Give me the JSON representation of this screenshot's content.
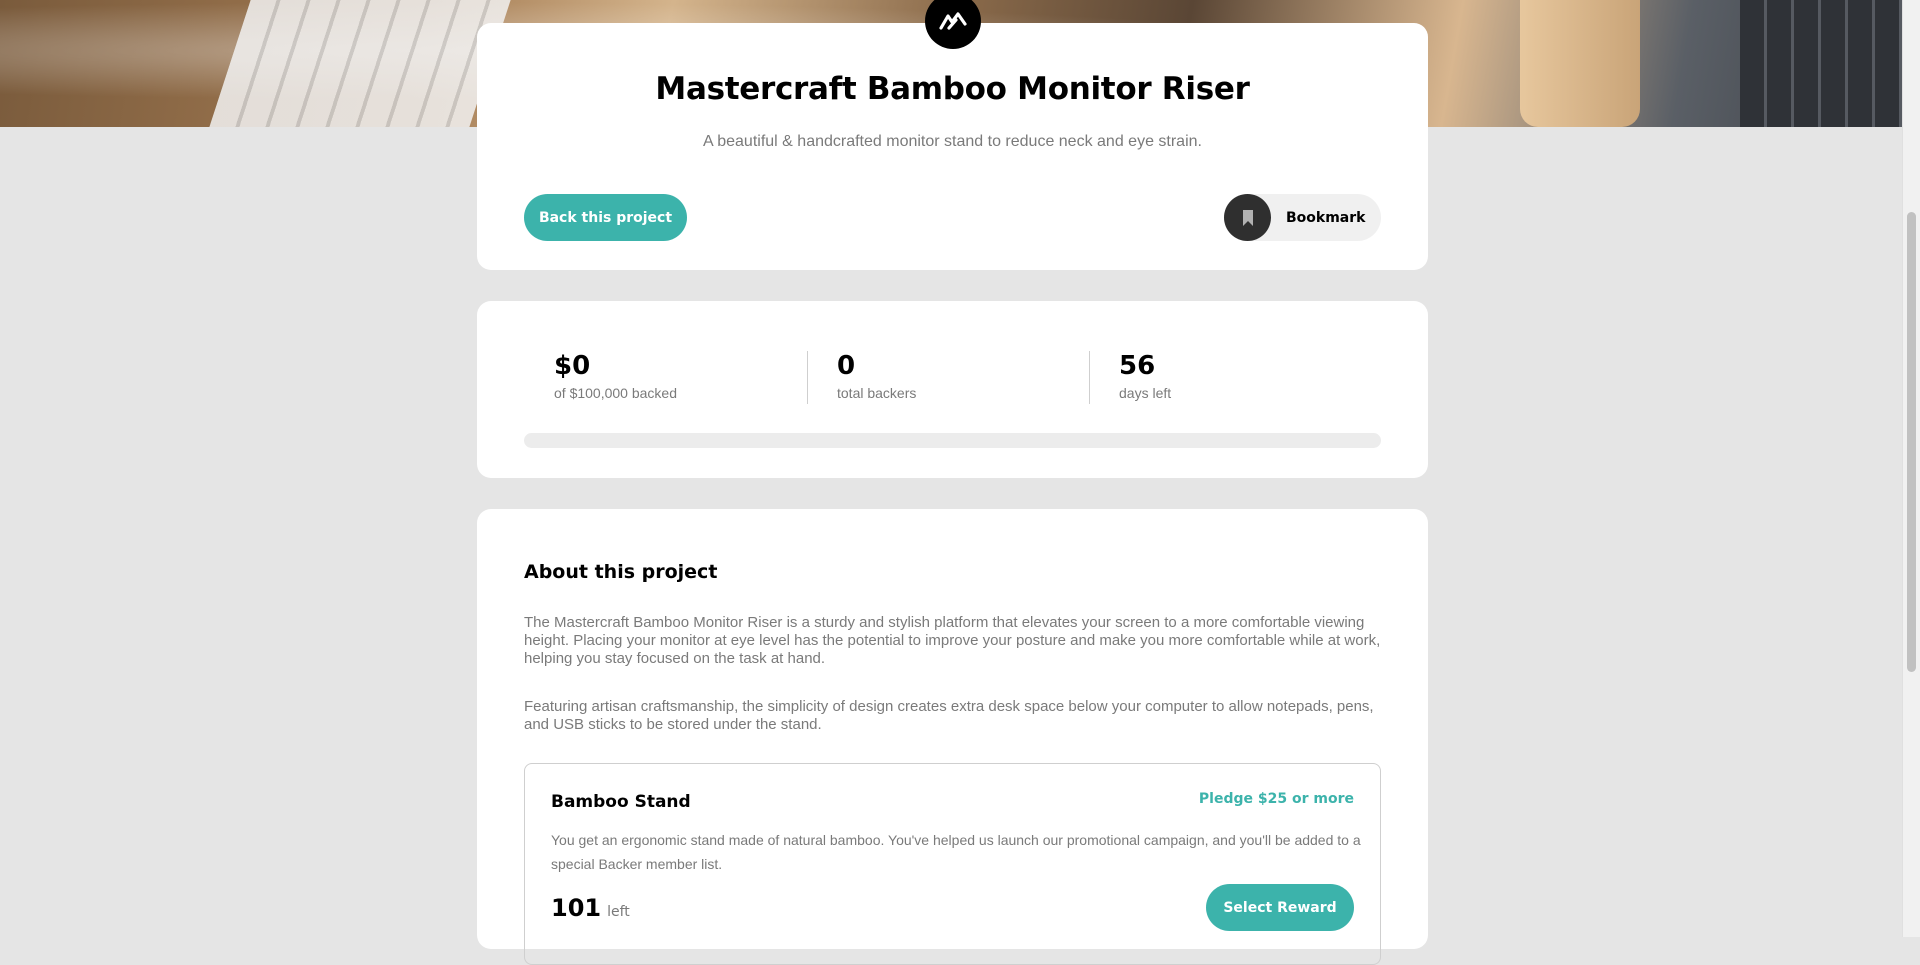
{
  "project": {
    "title": "Mastercraft Bamboo Monitor Riser",
    "subtitle": "A beautiful & handcrafted monitor stand to reduce neck and eye strain.",
    "back_label": "Back this project",
    "bookmark_label": "Bookmark"
  },
  "stats": {
    "backed": {
      "value": "$0",
      "label": "of $100,000 backed"
    },
    "backers": {
      "value": "0",
      "label": "total backers"
    },
    "days": {
      "value": "56",
      "label": "days left"
    },
    "progress_fraction": 0.0
  },
  "about": {
    "heading": "About this project",
    "paragraph1": "The Mastercraft Bamboo Monitor Riser is a sturdy and stylish platform that elevates your screen to a more comfortable viewing height. Placing your monitor at eye level has the potential to improve your posture and make you more comfortable while at work, helping you stay focused on the task at hand.",
    "paragraph2": "Featuring artisan craftsmanship, the simplicity of design creates extra desk space below your computer to allow notepads, pens, and USB sticks to be stored under the stand."
  },
  "reward": {
    "name": "Bamboo Stand",
    "pledge": "Pledge $25 or more",
    "description": "You get an ergonomic stand made of natural bamboo. You've helped us launch our promotional campaign, and you'll be added to a special Backer member list.",
    "left_count": "101",
    "left_word": "left",
    "select_label": "Select Reward"
  },
  "colors": {
    "accent": "#3cb3ab",
    "dark": "#2f2f2f",
    "muted_text": "#7a7a7a",
    "page_bg": "#e5e5e5"
  },
  "icons": {
    "logo": "mastercraft-logo-icon",
    "bookmark": "bookmark-icon"
  }
}
